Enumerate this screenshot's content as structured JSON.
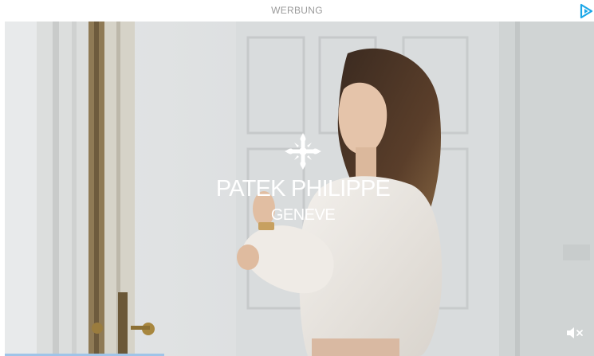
{
  "ad": {
    "label": "WERBUNG",
    "adchoices_icon": "adchoices-play-icon",
    "accent_color": "#1aa7e8"
  },
  "video": {
    "brand_name": "PATEK PHILIPPE",
    "brand_location": "GENEVE",
    "logo_icon": "calatrava-cross-icon",
    "mute_icon": "speaker-muted-icon",
    "progress": 0.27,
    "progress_color": "#9fc4e8"
  }
}
